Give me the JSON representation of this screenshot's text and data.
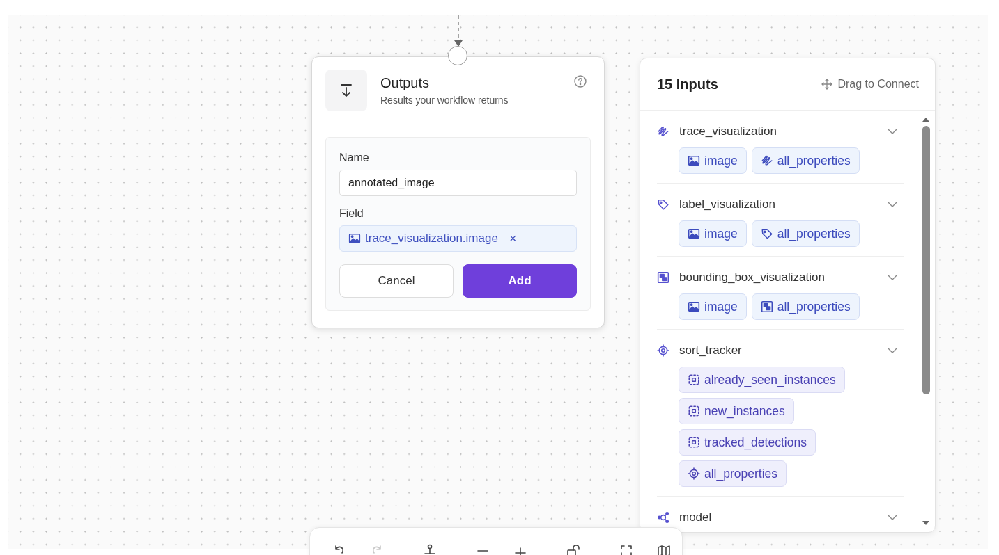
{
  "output_node": {
    "title": "Outputs",
    "subtitle": "Results your workflow returns",
    "name_label": "Name",
    "name_value": "annotated_image",
    "field_label": "Field",
    "field_chip": {
      "label": "trace_visualization.image",
      "kind": "image",
      "remove": "×"
    },
    "buttons": [
      {
        "label": "Cancel",
        "kind": "secondary"
      },
      {
        "label": "Add",
        "kind": "primary"
      }
    ]
  },
  "inputs_panel": {
    "title": "15 Inputs",
    "hint": "Drag to Connect",
    "groups": [
      {
        "name": "trace_visualization",
        "kind": "trace",
        "chips": [
          {
            "label": "image",
            "kind": "image"
          },
          {
            "label": "all_properties",
            "kind": "trace"
          }
        ]
      },
      {
        "name": "label_visualization",
        "kind": "tag",
        "chips": [
          {
            "label": "image",
            "kind": "image"
          },
          {
            "label": "all_properties",
            "kind": "tag"
          }
        ]
      },
      {
        "name": "bounding_box_visualization",
        "kind": "bbox",
        "chips": [
          {
            "label": "image",
            "kind": "image"
          },
          {
            "label": "all_properties",
            "kind": "bbox"
          }
        ]
      },
      {
        "name": "sort_tracker",
        "kind": "target",
        "chips": [
          {
            "label": "already_seen_instances",
            "kind": "detection"
          },
          {
            "label": "new_instances",
            "kind": "detection"
          },
          {
            "label": "tracked_detections",
            "kind": "detection"
          },
          {
            "label": "all_properties",
            "kind": "target"
          }
        ]
      },
      {
        "name": "model",
        "kind": "model"
      }
    ]
  },
  "toolbar": [
    [
      {
        "kind": "undo",
        "disabled": false
      },
      {
        "kind": "redo",
        "disabled": true
      }
    ],
    [
      {
        "kind": "anchor",
        "disabled": false
      }
    ],
    [
      {
        "kind": "zoom-out",
        "disabled": false
      },
      {
        "kind": "zoom-in",
        "disabled": false
      }
    ],
    [
      {
        "kind": "lock",
        "disabled": false
      }
    ],
    [
      {
        "kind": "fit",
        "disabled": false
      },
      {
        "kind": "map",
        "disabled": false
      }
    ]
  ]
}
